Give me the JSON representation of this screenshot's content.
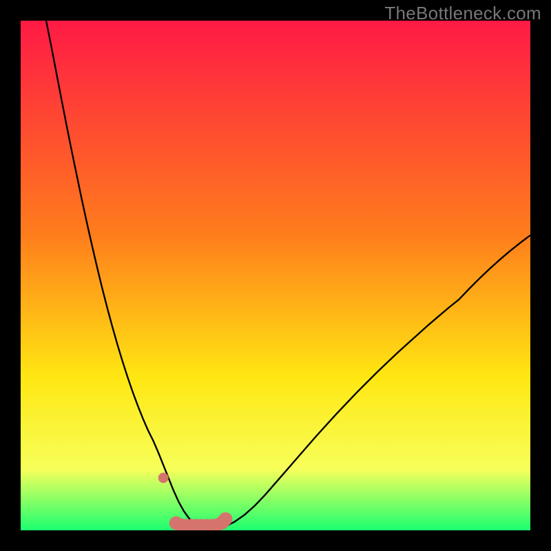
{
  "watermark": "TheBottleneck.com",
  "colors": {
    "frame": "#000000",
    "gradient_top": "#ff1a45",
    "gradient_mid1": "#ff7d1c",
    "gradient_mid2": "#ffe712",
    "gradient_mid3": "#f7ff5a",
    "gradient_bottom": "#1bff70",
    "curve": "#000000",
    "marker": "#d5746d"
  },
  "chart_data": {
    "type": "line",
    "title": "",
    "xlabel": "",
    "ylabel": "",
    "xlim": [
      0,
      100
    ],
    "ylim": [
      0,
      100
    ],
    "x": [
      5,
      6,
      7,
      8,
      9,
      10,
      11,
      12,
      13,
      14,
      15,
      16,
      17,
      18,
      19,
      20,
      21,
      22,
      23,
      24,
      25,
      26,
      27,
      28,
      29,
      30,
      31,
      32,
      33,
      34,
      35,
      36,
      38,
      40,
      42,
      44,
      46,
      48,
      50,
      52,
      54,
      56,
      58,
      60,
      62,
      64,
      66,
      68,
      70,
      72,
      74,
      76,
      78,
      80,
      82,
      84,
      86,
      88,
      90,
      92,
      94,
      96,
      98,
      100
    ],
    "y": [
      100,
      95,
      89.8,
      84.6,
      79.5,
      74.5,
      69.7,
      64.9,
      60.3,
      55.9,
      51.6,
      47.5,
      43.6,
      39.9,
      36.4,
      33.1,
      30,
      27.1,
      24.4,
      21.9,
      19.6,
      17.6,
      15.3,
      12.8,
      10.3,
      7.8,
      5.6,
      3.8,
      2.4,
      1.4,
      0.7,
      0.3,
      0.2,
      0.7,
      1.7,
      3.1,
      4.9,
      7,
      9.3,
      11.6,
      13.9,
      16.2,
      18.5,
      20.7,
      22.9,
      25,
      27.1,
      29.1,
      31.1,
      33,
      34.9,
      36.7,
      38.5,
      40.3,
      42,
      43.7,
      45.3,
      47.4,
      49.4,
      51.3,
      53.1,
      54.8,
      56.4,
      57.9
    ],
    "markers": {
      "x": [
        28,
        30.5,
        31.5,
        32.5,
        33.5,
        34.5,
        35.5,
        36.5,
        37.5,
        38.5,
        39.5,
        40.2
      ],
      "y": [
        10.3,
        1.4,
        1.0,
        0.9,
        0.9,
        0.9,
        0.9,
        0.9,
        0.9,
        1.0,
        1.5,
        2.2
      ]
    }
  }
}
